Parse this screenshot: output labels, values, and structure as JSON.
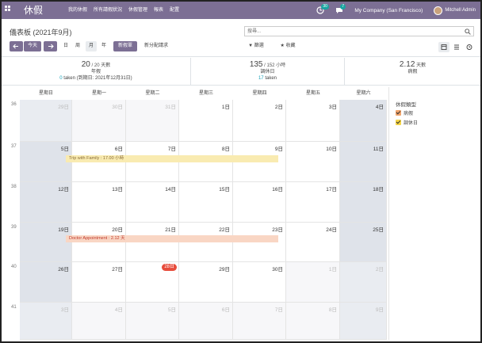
{
  "navbar": {
    "brand": "休假",
    "menu": [
      "我的休假",
      "所有請假狀況",
      "休假管理",
      "報表",
      "配置"
    ],
    "activity_count": "30",
    "message_count": "7",
    "company": "My Company (San Francisco)",
    "user": "Mitchell Admin"
  },
  "control": {
    "breadcrumb": "儀表板 (2021年9月)",
    "search_placeholder": "搜尋...",
    "today_label": "今天",
    "scale_day": "日",
    "scale_week": "周",
    "scale_month": "月",
    "scale_year": "年",
    "new_leave": "新假單",
    "new_allocation": "新分配請求",
    "filter_label": "篩選",
    "favorites_label": "收藏"
  },
  "summary": [
    {
      "value": "20",
      "total": "/ 20 天數",
      "name": "年假",
      "taken_num": "0",
      "taken_text": " taken (到期日: 2021年12月31日)"
    },
    {
      "value": "135",
      "total": "/ 152 小時",
      "name": "調休日",
      "taken_num": "17",
      "taken_text": " taken"
    },
    {
      "value": "2.12",
      "total": " 天數",
      "name": "病假",
      "taken_num": "",
      "taken_text": ""
    }
  ],
  "calendar": {
    "days_of_week": [
      "星期日",
      "星期一",
      "星期二",
      "星期三",
      "星期四",
      "星期五",
      "星期六"
    ],
    "weeks": [
      {
        "no": "36",
        "days": [
          "29日",
          "30日",
          "31日",
          "1日",
          "2日",
          "3日",
          "4日"
        ]
      },
      {
        "no": "37",
        "days": [
          "5日",
          "6日",
          "7日",
          "8日",
          "9日",
          "10日",
          "11日"
        ]
      },
      {
        "no": "38",
        "days": [
          "12日",
          "13日",
          "14日",
          "15日",
          "16日",
          "17日",
          "18日"
        ]
      },
      {
        "no": "39",
        "days": [
          "19日",
          "20日",
          "21日",
          "22日",
          "23日",
          "24日",
          "25日"
        ]
      },
      {
        "no": "40",
        "days": [
          "26日",
          "27日",
          "28日",
          "29日",
          "30日",
          "1日",
          "2日"
        ]
      },
      {
        "no": "41",
        "days": [
          "3日",
          "4日",
          "5日",
          "6日",
          "7日",
          "8日",
          "9日"
        ]
      }
    ],
    "events": {
      "trip": "Trip with Family : 17.00 小時",
      "doctor": "Doctor Appointment : 2.12 天"
    }
  },
  "sidebar": {
    "title": "休假類型",
    "types": [
      {
        "label": "病假",
        "color": "#f0a46c"
      },
      {
        "label": "調休日",
        "color": "#f5d547"
      }
    ]
  },
  "colors": {
    "brand": "#7c6f94",
    "today": "#e74c3c",
    "taken": "#17a2b8"
  }
}
